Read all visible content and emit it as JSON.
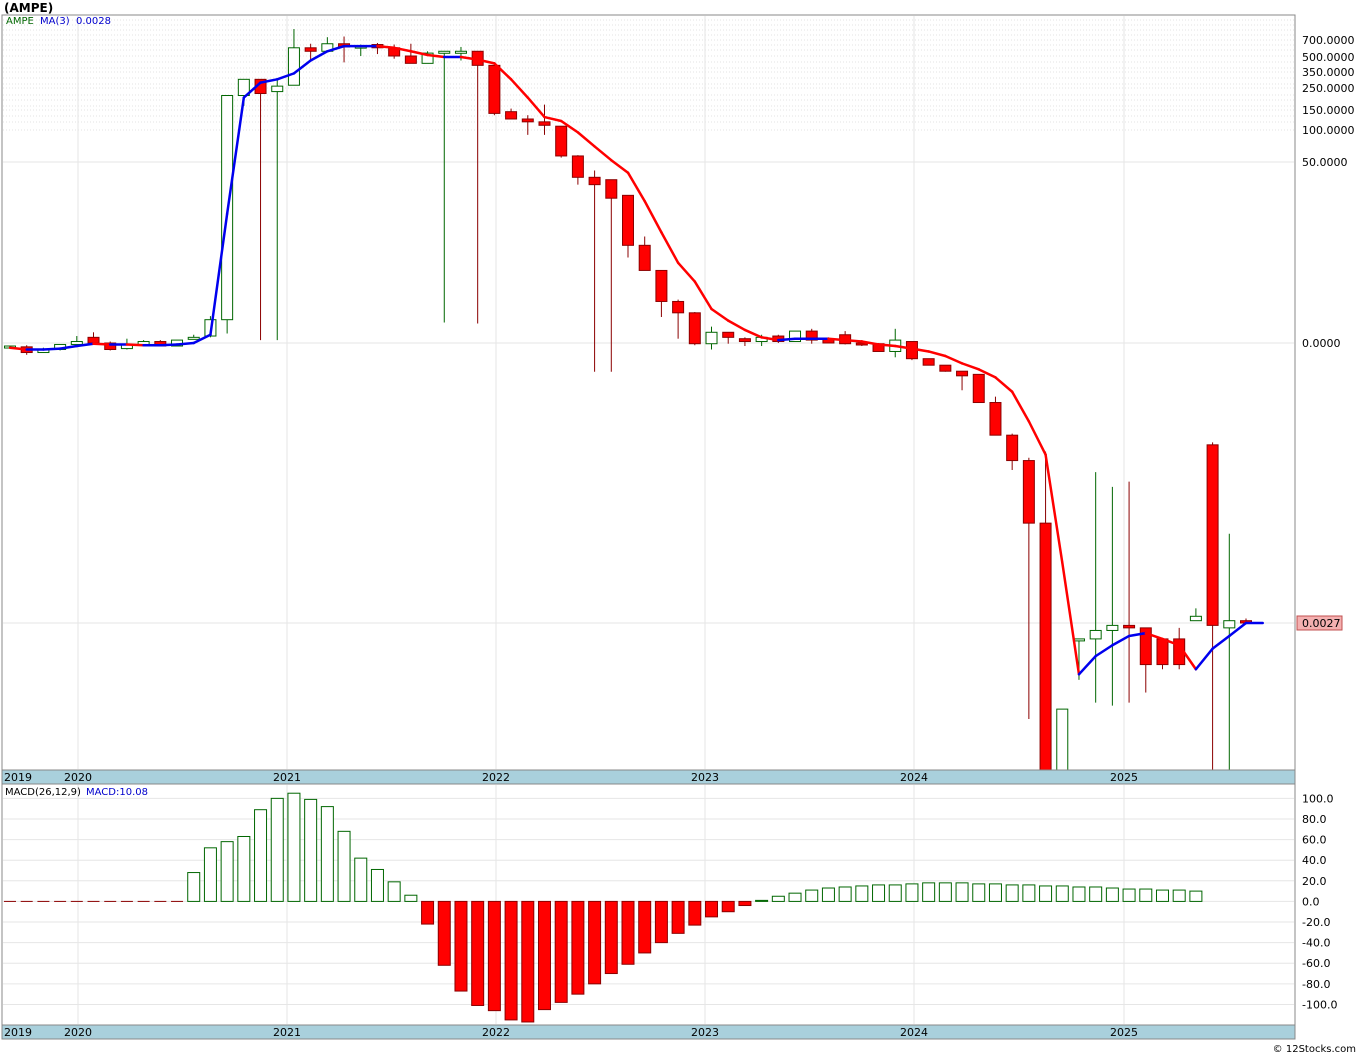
{
  "header": {
    "title": "(AMPE)",
    "legend_symbol": "AMPE",
    "legend_ma": "MA(3)",
    "legend_ma_value": "0.0028",
    "macd_label": "MACD(26,12,9)",
    "macd_value_label": "MACD:10.08",
    "last_price_badge": "0.0027",
    "watermark": "© 12Stocks.com"
  },
  "colors": {
    "up": "#006600",
    "down": "#ff0000",
    "ma_up": "#0000ee",
    "ma_down": "#ff0000",
    "axis_band": "#a9d0dc",
    "badge_bg": "#f4b0b0"
  },
  "chart_data": [
    {
      "type": "candlestick",
      "title": "(AMPE)",
      "scale": "log",
      "y_tick_labels": [
        "700.0000",
        "500.0000",
        "350.0000",
        "250.0000",
        "150.0000",
        "100.0000",
        "50.0000",
        "0.0000",
        "0.0027"
      ],
      "x_tick_labels": [
        "2019",
        "2020",
        "2021",
        "2022",
        "2023",
        "2024",
        "2025"
      ],
      "series": [
        {
          "name": "AMPE",
          "kind": "ohlc",
          "note": "monthly candles, y = price in $",
          "candles": [
            [
              2.7,
              2.8,
              2.5,
              2.8
            ],
            [
              2.7,
              2.9,
              1.9,
              2.1
            ],
            [
              2.1,
              2.6,
              2.1,
              2.4
            ],
            [
              2.4,
              3.0,
              2.3,
              3.0
            ],
            [
              3.0,
              3.7,
              3.0,
              3.3
            ],
            [
              3.6,
              4.0,
              3.2,
              3.2
            ],
            [
              3.2,
              3.3,
              2.3,
              2.4
            ],
            [
              2.5,
              3.5,
              2.4,
              3.0
            ],
            [
              3.0,
              3.4,
              2.9,
              3.3
            ],
            [
              3.3,
              3.4,
              2.8,
              2.8
            ],
            [
              2.8,
              3.4,
              2.8,
              3.4
            ],
            [
              3.5,
              3.8,
              3.5,
              3.6
            ],
            [
              3.7,
              5.6,
              3.6,
              5.2
            ],
            [
              5.2,
              210,
              3.9,
              210
            ],
            [
              210,
              300,
              165,
              300
            ],
            [
              300,
              300,
              3.4,
              220
            ],
            [
              230,
              305,
              3.4,
              260
            ],
            [
              265,
              870,
              265,
              600
            ],
            [
              600,
              650,
              470,
              560
            ],
            [
              560,
              740,
              555,
              650
            ],
            [
              650,
              750,
              440,
              610
            ],
            [
              610,
              640,
              510,
              620
            ],
            [
              640,
              660,
              530,
              600
            ],
            [
              600,
              640,
              480,
              510
            ],
            [
              510,
              650,
              440,
              430
            ],
            [
              430,
              560,
              430,
              540
            ],
            [
              550,
              560,
              4.9,
              560
            ],
            [
              560,
              610,
              460,
              560
            ],
            [
              560,
              550,
              4.8,
              410
            ],
            [
              410,
              420,
              135,
              140
            ],
            [
              145,
              155,
              125,
              125
            ],
            [
              125,
              135,
              90,
              118
            ],
            [
              118,
              170,
              90,
              110
            ],
            [
              108,
              105,
              55,
              57
            ],
            [
              57,
              58,
              40,
              43
            ],
            [
              43,
              46,
              0.9,
              40
            ],
            [
              42,
              42,
              0.9,
              35
            ],
            [
              36,
              36,
              19,
              22
            ],
            [
              22,
              24,
              15,
              14.5
            ],
            [
              14.5,
              14.4,
              5.5,
              7.6
            ],
            [
              7.6,
              7.9,
              3.5,
              6.0
            ],
            [
              6.0,
              6.1,
              2.9,
              3.1
            ],
            [
              3.1,
              4.5,
              2.4,
              4.0
            ],
            [
              4.0,
              4.0,
              3.1,
              3.6
            ],
            [
              3.5,
              3.6,
              2.8,
              3.3
            ],
            [
              3.3,
              3.8,
              2.8,
              3.6
            ],
            [
              3.7,
              3.8,
              3.2,
              3.3
            ],
            [
              3.3,
              3.8,
              3.3,
              4.1
            ],
            [
              4.1,
              4.3,
              3.1,
              3.4
            ],
            [
              3.5,
              3.6,
              3.3,
              3.2
            ],
            [
              3.8,
              4.1,
              3.0,
              3.1
            ],
            [
              3.2,
              3.4,
              2.8,
              3.0
            ],
            [
              3.1,
              3.2,
              2.4,
              2.2
            ],
            [
              2.2,
              4.3,
              1.7,
              3.4
            ],
            [
              3.3,
              3.2,
              1.5,
              1.6
            ],
            [
              1.6,
              1.6,
              1.3,
              1.2
            ],
            [
              1.2,
              1.2,
              0.9,
              0.92
            ],
            [
              0.92,
              0.92,
              0.42,
              0.75
            ],
            [
              0.8,
              0.8,
              0.33,
              0.28
            ],
            [
              0.28,
              0.34,
              0.1,
              0.095
            ],
            [
              0.095,
              0.1,
              0.03,
              0.041
            ],
            [
              0.041,
              0.045,
              0.0003,
              0.013
            ],
            [
              0.013,
              0.055,
              3e-05,
              0.0
            ],
            [
              0.0,
              0.0001,
              0.0,
              0.0005
            ],
            [
              0.0021,
              0.0021,
              0.0011,
              0.0021
            ],
            [
              0.0021,
              0.029,
              0.0007,
              0.0024
            ],
            [
              0.0024,
              0.023,
              0.0006,
              0.0026
            ],
            [
              0.0026,
              0.025,
              0.0007,
              0.0025
            ],
            [
              0.0025,
              0.0025,
              0.0009,
              0.0014
            ],
            [
              0.0021,
              0.0021,
              0.0013,
              0.0014
            ],
            [
              0.0021,
              0.0025,
              0.0013,
              0.0014
            ],
            [
              0.0028,
              0.0034,
              0.0028,
              0.003
            ],
            [
              0.069,
              0.075,
              0.0,
              0.0026
            ],
            [
              0.0025,
              0.011,
              0.0,
              0.0028
            ],
            [
              0.0028,
              0.0029,
              0.0027,
              0.0027
            ]
          ]
        },
        {
          "name": "MA(3)",
          "kind": "line",
          "values": [
            2.6,
            2.4,
            2.4,
            2.5,
            2.8,
            3.1,
            3.0,
            3.0,
            2.9,
            2.9,
            3.0,
            3.2,
            3.8,
            30,
            200,
            280,
            300,
            340,
            460,
            560,
            620,
            620,
            620,
            600,
            560,
            520,
            500,
            500,
            470,
            430,
            300,
            200,
            130,
            120,
            95,
            70,
            52,
            45,
            34,
            25,
            17,
            11.5,
            6.5,
            5.1,
            4.2,
            3.6,
            3.4,
            3.5,
            3.5,
            3.5,
            3.4,
            3.3,
            3.0,
            2.8,
            2.5,
            2.2,
            1.8,
            1.3,
            1.0,
            0.7,
            0.4,
            0.15,
            0.05,
            0.007,
            0.0012,
            0.0016,
            0.0019,
            0.0022,
            0.0023,
            0.0021,
            0.0019,
            0.0013,
            0.0018,
            0.0022,
            0.0027,
            0.0027
          ]
        },
        {
          "name": "MACD(26,12,9)",
          "kind": "histogram",
          "y_tick_labels": [
            "100.0",
            "80.0",
            "60.0",
            "40.0",
            "20.0",
            "0.0",
            "-20.0",
            "-40.0",
            "-60.0",
            "-80.0",
            "-100.0"
          ],
          "ylim": [
            -118,
            112
          ],
          "values": [
            0,
            0,
            0,
            0,
            0,
            0,
            0,
            0,
            0,
            0,
            0,
            28,
            52,
            58,
            63,
            89,
            100,
            105,
            99,
            92,
            68,
            42,
            31,
            19,
            6,
            -22,
            -62,
            -87,
            -101,
            -106,
            -115,
            -117,
            -105,
            -98,
            -90,
            -80,
            -70,
            -61,
            -50,
            -40,
            -31,
            -23,
            -15,
            -10,
            -4,
            1,
            5,
            8,
            11,
            13,
            14,
            15,
            16,
            16,
            17,
            18,
            18,
            18,
            17,
            17,
            16,
            16,
            15,
            15,
            14,
            14,
            13,
            12,
            12,
            11,
            11,
            10
          ]
        }
      ]
    }
  ]
}
